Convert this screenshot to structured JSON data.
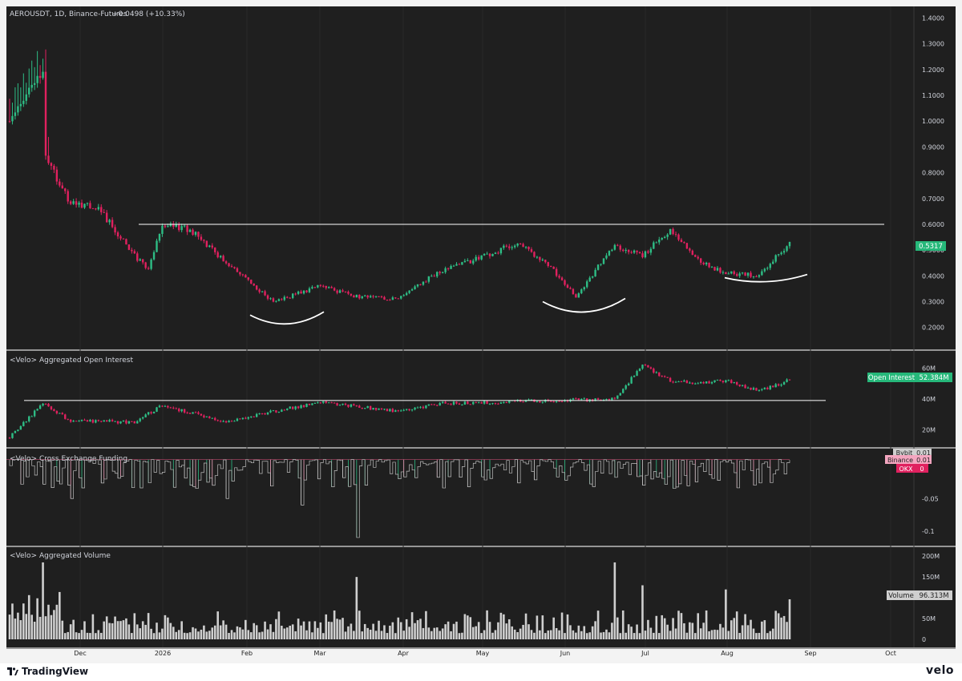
{
  "window": {
    "brand_left": "TradingView",
    "brand_right": "velo"
  },
  "panes": {
    "price": {
      "symbol": "AEROUSDT, 1D, Binance-Futures",
      "change": "+0.0498 (+10.33%)",
      "price_label": "0.5317",
      "resistance_level": 0.6
    },
    "open_interest": {
      "title": "<Velo> Aggregated Open Interest",
      "label": "Open Interest",
      "value": "52.384M",
      "support_level": 39
    },
    "funding": {
      "title": "<Velo> Cross Exchange Funding",
      "labels": [
        {
          "name": "Bybit",
          "value": "0.01"
        },
        {
          "name": "Binance",
          "value": "0.01"
        },
        {
          "name": "OKX",
          "value": "0"
        }
      ]
    },
    "volume": {
      "title": "<Velo> Aggregated Volume",
      "label": "Volume",
      "value": "96.313M"
    }
  },
  "colors": {
    "background": "#1f1f1f",
    "up": "#2ebd85",
    "down": "#e0215f",
    "volume": "#cfcfcf",
    "text": "#d1d4dc",
    "line": "#ffffff",
    "footer": "#ffffff"
  },
  "chart_data": [
    {
      "type": "candlestick",
      "title": "AEROUSDT, 1D, Binance-Futures",
      "x_ticks": [
        "Dec",
        "2026",
        "Feb",
        "Mar",
        "Apr",
        "May",
        "Jun",
        "Jul",
        "Aug",
        "Sep",
        "Oct"
      ],
      "y_ticks": [
        "1.4000",
        "1.3000",
        "1.2000",
        "1.1000",
        "1.0000",
        "0.9000",
        "0.8000",
        "0.7000",
        "0.6000",
        "0.5000",
        "0.4000",
        "0.3000",
        "0.2000"
      ],
      "ylim": [
        0.14,
        1.42
      ],
      "date_range": [
        "Nov 2025",
        "Aug 2026"
      ],
      "anchors": [
        {
          "x": "mid Nov",
          "y": 1.0
        },
        {
          "x": "late Nov",
          "y": 1.18
        },
        {
          "x": "late Nov",
          "y": 0.88
        },
        {
          "x": "early Dec",
          "y": 0.68
        },
        {
          "x": "mid Dec",
          "y": 0.66
        },
        {
          "x": "late Dec",
          "y": 0.48
        },
        {
          "x": "end Dec",
          "y": 0.42
        },
        {
          "x": "early Jan",
          "y": 0.6
        },
        {
          "x": "mid Jan",
          "y": 0.58
        },
        {
          "x": "late Jan",
          "y": 0.45
        },
        {
          "x": "mid Feb",
          "y": 0.3
        },
        {
          "x": "early Mar",
          "y": 0.36
        },
        {
          "x": "mid Mar",
          "y": 0.32
        },
        {
          "x": "early Apr",
          "y": 0.31
        },
        {
          "x": "mid Apr",
          "y": 0.42
        },
        {
          "x": "early May",
          "y": 0.47
        },
        {
          "x": "mid May",
          "y": 0.53
        },
        {
          "x": "late May",
          "y": 0.42
        },
        {
          "x": "early Jun",
          "y": 0.32
        },
        {
          "x": "mid Jun",
          "y": 0.52
        },
        {
          "x": "late Jun",
          "y": 0.48
        },
        {
          "x": "early Jul",
          "y": 0.58
        },
        {
          "x": "mid Jul",
          "y": 0.46
        },
        {
          "x": "late Jul",
          "y": 0.41
        },
        {
          "x": "mid Aug",
          "y": 0.4
        },
        {
          "x": "late Aug",
          "y": 0.5317
        }
      ],
      "horizontal_line": 0.6,
      "annotations": [
        "rounded bottom Feb–Mar",
        "rounded bottom Jun",
        "rounded bottom Aug"
      ]
    },
    {
      "type": "candlestick",
      "title": "<Velo> Aggregated Open Interest",
      "y_ticks": [
        "60M",
        "40M",
        "20M"
      ],
      "ylim": [
        12,
        68
      ],
      "anchors": [
        {
          "x": "mid Nov",
          "y": 15
        },
        {
          "x": "late Nov",
          "y": 37
        },
        {
          "x": "early Dec",
          "y": 26
        },
        {
          "x": "late Dec",
          "y": 25
        },
        {
          "x": "early Jan",
          "y": 36
        },
        {
          "x": "late Jan",
          "y": 25
        },
        {
          "x": "mid Feb",
          "y": 32
        },
        {
          "x": "early Mar",
          "y": 38
        },
        {
          "x": "early Apr",
          "y": 32
        },
        {
          "x": "mid Apr",
          "y": 37
        },
        {
          "x": "late May",
          "y": 39
        },
        {
          "x": "mid Jun",
          "y": 40
        },
        {
          "x": "late Jun",
          "y": 62
        },
        {
          "x": "early Jul",
          "y": 52
        },
        {
          "x": "mid Jul",
          "y": 50
        },
        {
          "x": "late Jul",
          "y": 52
        },
        {
          "x": "mid Aug",
          "y": 45
        },
        {
          "x": "late Aug",
          "y": 52.384
        }
      ],
      "horizontal_line": 39,
      "last_value": 52.384
    },
    {
      "type": "bar",
      "title": "<Velo> Cross Exchange Funding",
      "y_ticks": [
        "-0.05",
        "-0.1"
      ],
      "ylim": [
        -0.115,
        0.012
      ],
      "series": [
        {
          "name": "Bybit",
          "last": 0.01
        },
        {
          "name": "Binance",
          "last": 0.01
        },
        {
          "name": "OKX",
          "last": 0
        }
      ],
      "notable_values": [
        {
          "x": "mid Mar",
          "y": -0.11
        },
        {
          "x": "late Feb",
          "y": -0.06
        },
        {
          "x": "late Jan",
          "y": -0.05
        },
        {
          "x": "early Dec",
          "y": -0.05
        }
      ]
    },
    {
      "type": "bar",
      "title": "<Velo> Aggregated Volume",
      "y_ticks": [
        "200M",
        "150M",
        "100M",
        "50M",
        "0"
      ],
      "ylim": [
        0,
        210
      ],
      "notable_values": [
        {
          "x": "late Nov",
          "y": 185
        },
        {
          "x": "mid Mar",
          "y": 150
        },
        {
          "x": "mid Jun",
          "y": 185
        },
        {
          "x": "late Jun",
          "y": 130
        },
        {
          "x": "late Jul",
          "y": 120
        }
      ],
      "last_value": 96.313
    }
  ]
}
